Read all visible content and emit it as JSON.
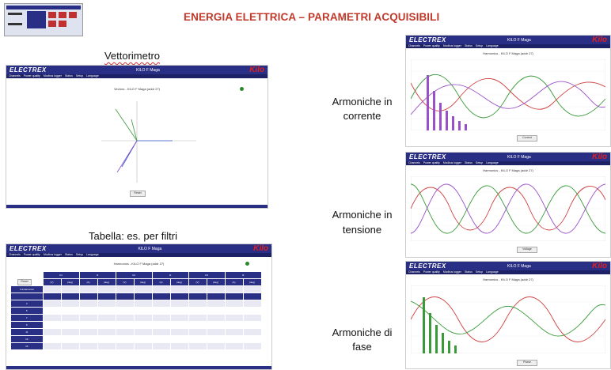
{
  "page_title": "ENERGIA ELETTRICA – PARAMETRI ACQUISIBILI",
  "labels": {
    "vettorimetro": "Vettorimetro",
    "tabella": "Tabella: es. per filtri",
    "armoniche_corrente_1": "Armoniche in",
    "armoniche_corrente_2": "corrente",
    "armoniche_tensione_1": "Armoniche in",
    "armoniche_tensione_2": "tensione",
    "armoniche_fase_1": "Armoniche di",
    "armoniche_fase_2": "fase"
  },
  "app": {
    "logo": "ELECTREX",
    "device_name": "KILO F Maga",
    "brand": "Kilo",
    "nav": [
      "Channels",
      "Power quality",
      "Modbus logger",
      "Status",
      "Setup",
      "Language"
    ]
  },
  "vector_panel": {
    "heading": "Vectors - KILO F Maga (addr 27)",
    "button": "Reset"
  },
  "table_panel": {
    "heading": "Harmonics - KILO F Maga (addr 27)",
    "reset_button": "Reset",
    "col_groups": [
      "U1",
      "I1",
      "U2",
      "I2",
      "U3",
      "I3"
    ],
    "units": [
      "(V)",
      "(deg)",
      "(A)",
      "(deg)",
      "(V)",
      "(deg)",
      "(A)",
      "(deg)",
      "(V)",
      "(deg)",
      "(A)",
      "(deg)"
    ],
    "row_labels": [
      "Fundamental",
      "",
      "3",
      "5",
      "7",
      "9",
      "11",
      "13",
      "15"
    ]
  },
  "harm_panels": [
    {
      "heading": "Harmonics - KILO F Maga (addr 27)",
      "select": "Current"
    },
    {
      "heading": "Harmonics - KILO F Maga (addr 27)",
      "select": "Voltage"
    },
    {
      "heading": "Harmonics - KILO F Maga (addr 27)",
      "select": "Phase"
    }
  ],
  "colors": {
    "title_red": "#c0392b",
    "bar_blue": "#2a2f86",
    "red_wave": "#d04040",
    "green_wave": "#3a9a3a",
    "purple_wave": "#9a50c8"
  }
}
